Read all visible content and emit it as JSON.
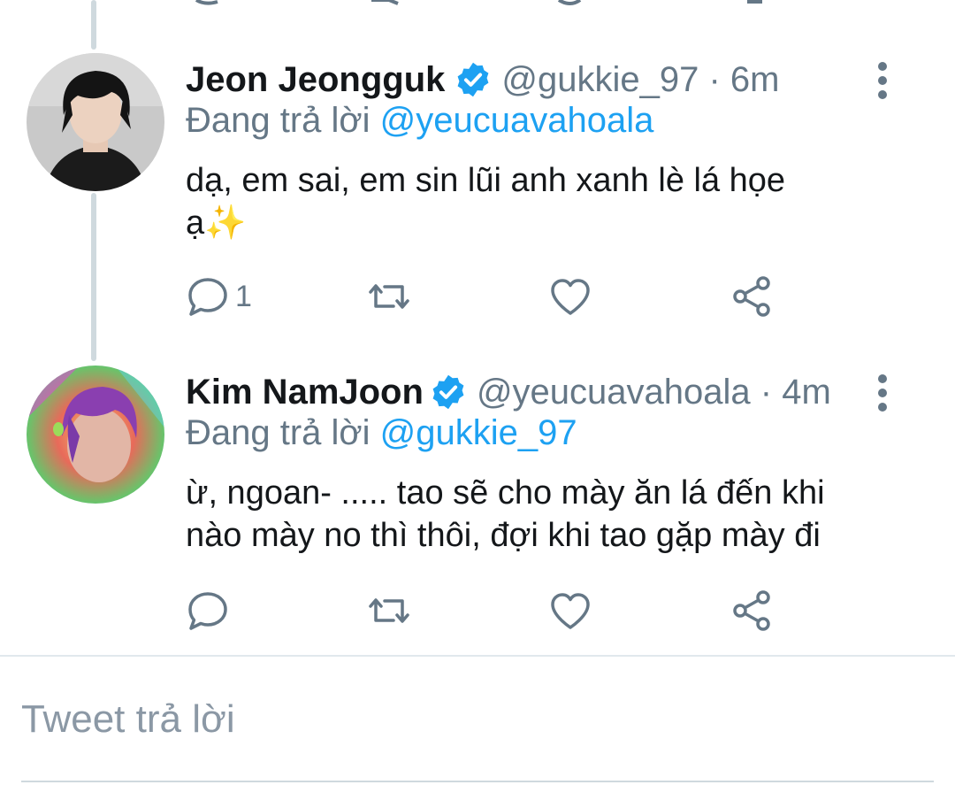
{
  "tweets": [
    {
      "name": "Jeon Jeongguk",
      "handle": "@gukkie_97",
      "time": "· 6m",
      "replying_label": "Đang trả lời",
      "replying_to": "@yeucuavahoala",
      "text_line1": "dạ, em sai, em sin lũi anh xanh lè lá họe",
      "text_line2": "ạ✨",
      "reply_count": "1",
      "verified": true
    },
    {
      "name": "Kim NamJoon",
      "handle": "@yeucuavahoala",
      "time": "· 4m",
      "replying_label": "Đang trả lời",
      "replying_to": "@gukkie_97",
      "text_line1": "ừ, ngoan- ..... tao sẽ cho mày ăn lá đến khi",
      "text_line2": "nào mày no thì thôi, đợi khi tao gặp mày đi",
      "reply_count": "",
      "verified": true
    }
  ],
  "composer": {
    "placeholder": "Tweet trả lời"
  },
  "icons": {
    "reply": "reply-icon",
    "retweet": "retweet-icon",
    "like": "heart-icon",
    "share": "share-icon",
    "more": "more-vertical-icon",
    "verified": "verified-badge-icon"
  },
  "colors": {
    "accent": "#1da1f2",
    "secondary_text": "#657786",
    "primary_text": "#14171a"
  }
}
